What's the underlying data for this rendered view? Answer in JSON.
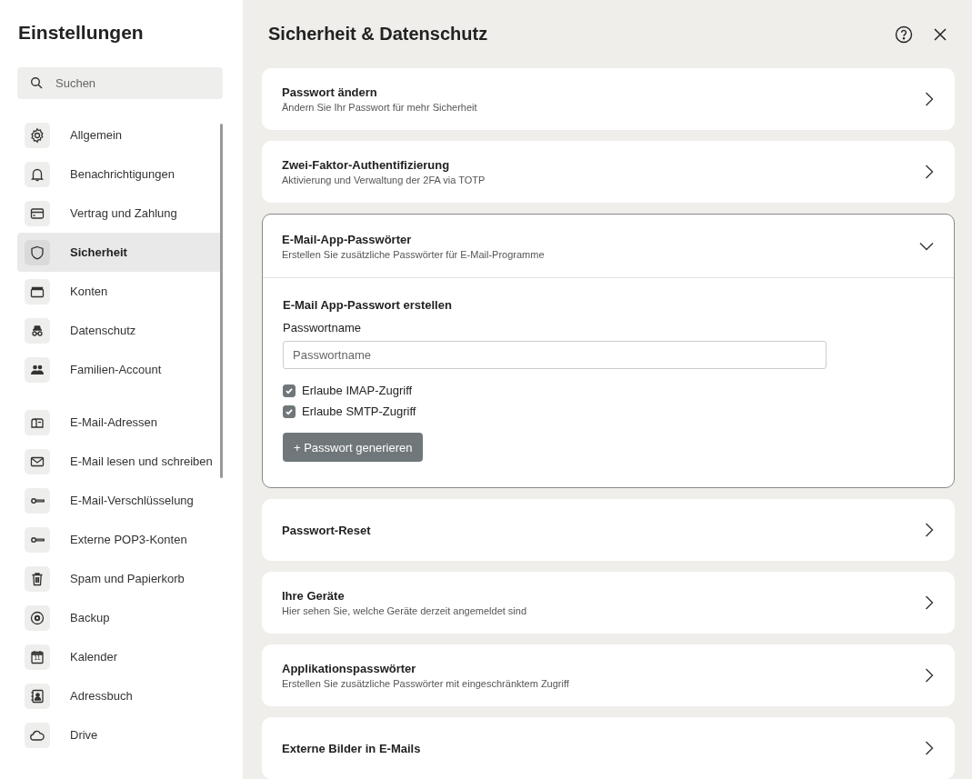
{
  "sidebar": {
    "title": "Einstellungen",
    "search": {
      "placeholder": "Suchen"
    },
    "groups": [
      {
        "items": [
          {
            "label": "Allgemein",
            "selected": false
          },
          {
            "label": "Benachrichtigungen",
            "selected": false
          },
          {
            "label": "Vertrag und Zahlung",
            "selected": false
          },
          {
            "label": "Sicherheit",
            "selected": true
          },
          {
            "label": "Konten",
            "selected": false
          },
          {
            "label": "Datenschutz",
            "selected": false
          },
          {
            "label": "Familien-Account",
            "selected": false
          }
        ]
      },
      {
        "items": [
          {
            "label": "E-Mail-Adressen",
            "selected": false
          },
          {
            "label": "E-Mail lesen und schreiben",
            "selected": false
          },
          {
            "label": "E-Mail-Verschlüsselung",
            "selected": false
          },
          {
            "label": "Externe POP3-Konten",
            "selected": false
          },
          {
            "label": "Spam und Papierkorb",
            "selected": false
          },
          {
            "label": "Backup",
            "selected": false
          },
          {
            "label": "Kalender",
            "selected": false,
            "icon_text": "11"
          },
          {
            "label": "Adressbuch",
            "selected": false
          },
          {
            "label": "Drive",
            "selected": false
          }
        ]
      }
    ]
  },
  "main": {
    "title": "Sicherheit & Datenschutz",
    "cards": [
      {
        "title": "Passwort ändern",
        "subtitle": "Ändern Sie Ihr Passwort für mehr Sicherheit",
        "expanded": false
      },
      {
        "title": "Zwei-Faktor-Authentifizierung",
        "subtitle": "Aktivierung und Verwaltung der 2FA via TOTP",
        "expanded": false
      },
      {
        "title": "E-Mail-App-Passwörter",
        "subtitle": "Erstellen Sie zusätzliche Passwörter für E-Mail-Programme",
        "expanded": true,
        "form": {
          "heading": "E-Mail App-Passwort erstellen",
          "field_label": "Passwortname",
          "placeholder": "Passwortname",
          "checkboxes": [
            {
              "label": "Erlaube IMAP-Zugriff",
              "checked": true
            },
            {
              "label": "Erlaube SMTP-Zugriff",
              "checked": true
            }
          ],
          "button": "+ Passwort generieren"
        }
      },
      {
        "title": "Passwort-Reset",
        "expanded": false
      },
      {
        "title": "Ihre Geräte",
        "subtitle": "Hier sehen Sie, welche Geräte derzeit angemeldet sind",
        "expanded": false
      },
      {
        "title": "Applikationspasswörter",
        "subtitle": "Erstellen Sie zusätzliche Passwörter mit eingeschränktem Zugriff",
        "expanded": false
      },
      {
        "title": "Externe Bilder in E-Mails",
        "expanded": false
      }
    ]
  }
}
